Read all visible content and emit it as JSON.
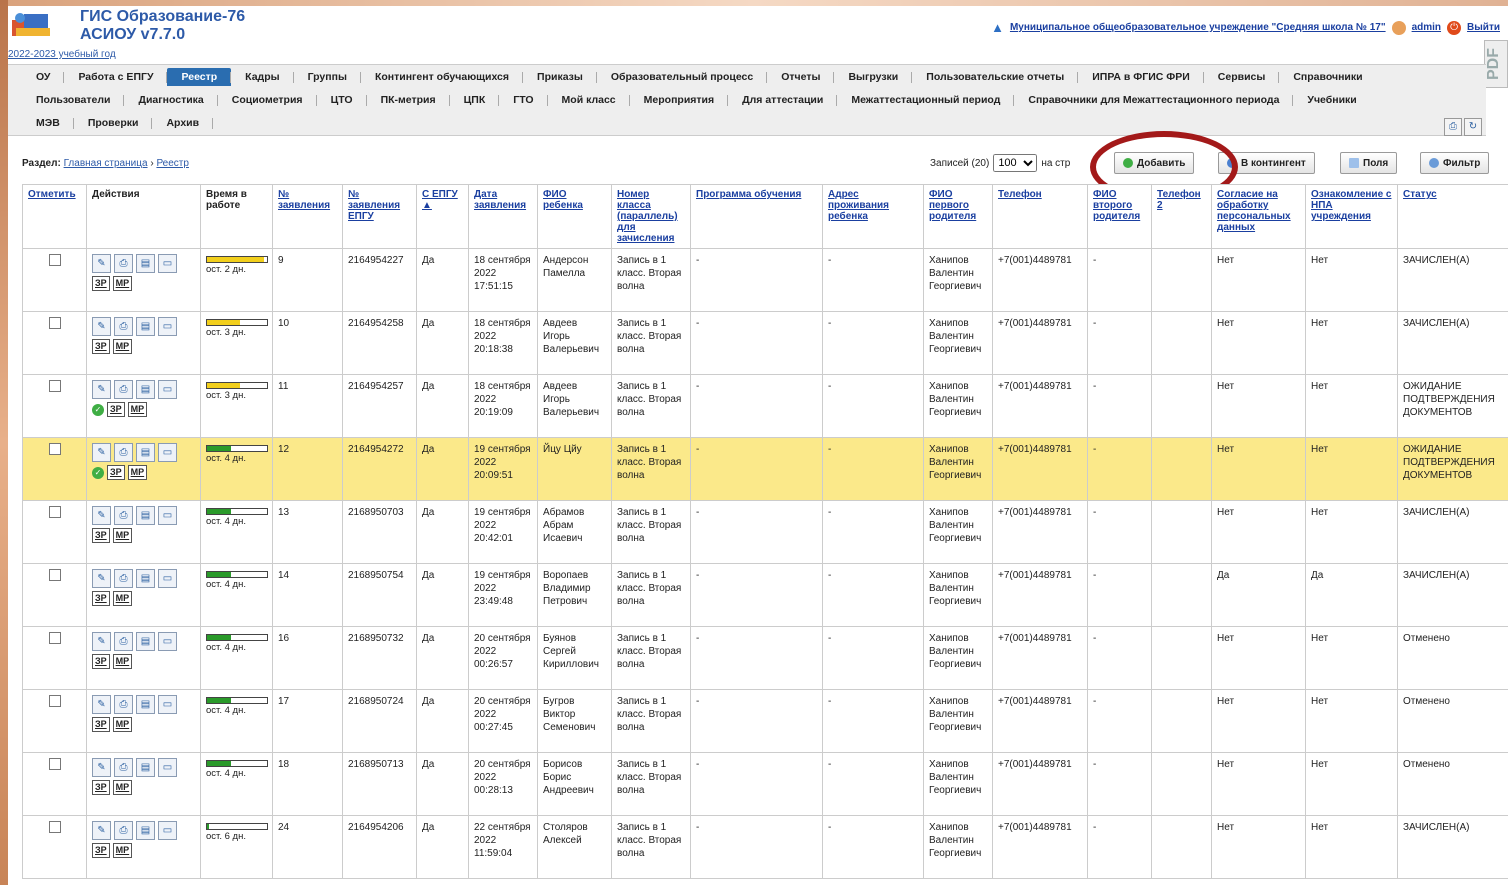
{
  "header": {
    "title_line1": "ГИС Образование-76",
    "title_line2": "АСИОУ v7.7.0",
    "year_link": "2022-2023 учебный год",
    "org_link": "Муниципальное общеобразовательное учреждение \"Средняя школа № 17\"",
    "user": "admin",
    "exit": "Выйти",
    "pdf_badge": "PDF"
  },
  "menu": {
    "row1": [
      "ОУ",
      "Работа с ЕПГУ",
      "Реестр",
      "Кадры",
      "Группы",
      "Контингент обучающихся",
      "Приказы",
      "Образовательный процесс",
      "Отчеты",
      "Выгрузки",
      "Пользовательские отчеты",
      "ИПРА в ФГИС ФРИ",
      "Сервисы",
      "Справочники"
    ],
    "row2": [
      "Пользователи",
      "Диагностика",
      "Социометрия",
      "ЦТО",
      "ПК-метрия",
      "ЦПК",
      "ГТО",
      "Мой класс",
      "Мероприятия",
      "Для аттестации",
      "Межаттестационный период",
      "Справочники для Межаттестационного периода",
      "Учебники"
    ],
    "row3": [
      "МЭВ",
      "Проверки",
      "Архив"
    ],
    "active": "Реестр"
  },
  "toolbar": {
    "section_label": "Раздел:",
    "crumb_home": "Главная страница",
    "crumb_sep": "›",
    "crumb_current": "Реестр",
    "records_label": "Записей (20)",
    "per_page": "100",
    "per_page_suffix": "на стр",
    "add": "Добавить",
    "to_contingent": "В контингент",
    "fields": "Поля",
    "filter": "Фильтр"
  },
  "table": {
    "headers": [
      "Отметить",
      "Действия",
      "Время в работе",
      "№ заявления",
      "№ заявления ЕПГУ",
      "С ЕПГУ ▲",
      "Дата заявления",
      "ФИО ребенка",
      "Номер класса (параллель) для зачисления",
      "Программа обучения",
      "Адрес проживания ребенка",
      "ФИО первого родителя",
      "Телефон",
      "ФИО второго родителя",
      "Телефон 2",
      "Согласие на обработку персональных данных",
      "Ознакомление с НПА учреждения",
      "Статус"
    ],
    "tag_er": "ЗР",
    "tag_mr": "МР",
    "rows": [
      {
        "days": "ост. 2 дн.",
        "fill": 0.95,
        "color": "#f2cf1c",
        "num": "9",
        "epgu": "2164954227",
        "from_epgu": "Да",
        "date": "18 сентября 2022 17:51:15",
        "fio": "Андерсон Памелла",
        "class": "Запись в 1 класс. Вторая волна",
        "prog": "-",
        "addr": "-",
        "parent": "Ханипов Валентин Георгиевич",
        "phone": "+7(001)4489781",
        "parent2": "-",
        "phone2": "",
        "consent": "Нет",
        "npa": "Нет",
        "status": "ЗАЧИСЛЕН(А)",
        "ok": false,
        "hl": false
      },
      {
        "days": "ост. 3 дн.",
        "fill": 0.55,
        "color": "#f2cf1c",
        "num": "10",
        "epgu": "2164954258",
        "from_epgu": "Да",
        "date": "18 сентября 2022 20:18:38",
        "fio": "Авдеев Игорь Валерьевич",
        "class": "Запись в 1 класс. Вторая волна",
        "prog": "-",
        "addr": "-",
        "parent": "Ханипов Валентин Георгиевич",
        "phone": "+7(001)4489781",
        "parent2": "-",
        "phone2": "",
        "consent": "Нет",
        "npa": "Нет",
        "status": "ЗАЧИСЛЕН(А)",
        "ok": false,
        "hl": false
      },
      {
        "days": "ост. 3 дн.",
        "fill": 0.55,
        "color": "#f2cf1c",
        "num": "11",
        "epgu": "2164954257",
        "from_epgu": "Да",
        "date": "18 сентября 2022 20:19:09",
        "fio": "Авдеев Игорь Валерьевич",
        "class": "Запись в 1 класс. Вторая волна",
        "prog": "-",
        "addr": "-",
        "parent": "Ханипов Валентин Георгиевич",
        "phone": "+7(001)4489781",
        "parent2": "-",
        "phone2": "",
        "consent": "Нет",
        "npa": "Нет",
        "status": "ОЖИДАНИЕ ПОДТВЕРЖДЕНИЯ ДОКУМЕНТОВ",
        "ok": true,
        "hl": false
      },
      {
        "days": "ост. 4 дн.",
        "fill": 0.4,
        "color": "#2a9a2a",
        "num": "12",
        "epgu": "2164954272",
        "from_epgu": "Да",
        "date": "19 сентября 2022 20:09:51",
        "fio": "Йцу Цйу",
        "class": "Запись в 1 класс. Вторая волна",
        "prog": "-",
        "addr": "-",
        "parent": "Ханипов Валентин Георгиевич",
        "phone": "+7(001)4489781",
        "parent2": "-",
        "phone2": "",
        "consent": "Нет",
        "npa": "Нет",
        "status": "ОЖИДАНИЕ ПОДТВЕРЖДЕНИЯ ДОКУМЕНТОВ",
        "ok": true,
        "hl": true
      },
      {
        "days": "ост. 4 дн.",
        "fill": 0.4,
        "color": "#2a9a2a",
        "num": "13",
        "epgu": "2168950703",
        "from_epgu": "Да",
        "date": "19 сентября 2022 20:42:01",
        "fio": "Абрамов Абрам Исаевич",
        "class": "Запись в 1 класс. Вторая волна",
        "prog": "-",
        "addr": "-",
        "parent": "Ханипов Валентин Георгиевич",
        "phone": "+7(001)4489781",
        "parent2": "-",
        "phone2": "",
        "consent": "Нет",
        "npa": "Нет",
        "status": "ЗАЧИСЛЕН(А)",
        "ok": false,
        "hl": false
      },
      {
        "days": "ост. 4 дн.",
        "fill": 0.4,
        "color": "#2a9a2a",
        "num": "14",
        "epgu": "2168950754",
        "from_epgu": "Да",
        "date": "19 сентября 2022 23:49:48",
        "fio": "Воропаев Владимир Петрович",
        "class": "Запись в 1 класс. Вторая волна",
        "prog": "-",
        "addr": "-",
        "parent": "Ханипов Валентин Георгиевич",
        "phone": "+7(001)4489781",
        "parent2": "-",
        "phone2": "",
        "consent": "Да",
        "npa": "Да",
        "status": "ЗАЧИСЛЕН(А)",
        "ok": false,
        "hl": false
      },
      {
        "days": "ост. 4 дн.",
        "fill": 0.4,
        "color": "#2a9a2a",
        "num": "16",
        "epgu": "2168950732",
        "from_epgu": "Да",
        "date": "20 сентября 2022 00:26:57",
        "fio": "Буянов Сергей Кириллович",
        "class": "Запись в 1 класс. Вторая волна",
        "prog": "-",
        "addr": "-",
        "parent": "Ханипов Валентин Георгиевич",
        "phone": "+7(001)4489781",
        "parent2": "-",
        "phone2": "",
        "consent": "Нет",
        "npa": "Нет",
        "status": "Отменено",
        "ok": false,
        "hl": false
      },
      {
        "days": "ост. 4 дн.",
        "fill": 0.4,
        "color": "#2a9a2a",
        "num": "17",
        "epgu": "2168950724",
        "from_epgu": "Да",
        "date": "20 сентября 2022 00:27:45",
        "fio": "Бугров Виктор Семенович",
        "class": "Запись в 1 класс. Вторая волна",
        "prog": "-",
        "addr": "-",
        "parent": "Ханипов Валентин Георгиевич",
        "phone": "+7(001)4489781",
        "parent2": "-",
        "phone2": "",
        "consent": "Нет",
        "npa": "Нет",
        "status": "Отменено",
        "ok": false,
        "hl": false
      },
      {
        "days": "ост. 4 дн.",
        "fill": 0.4,
        "color": "#2a9a2a",
        "num": "18",
        "epgu": "2168950713",
        "from_epgu": "Да",
        "date": "20 сентября 2022 00:28:13",
        "fio": "Борисов Борис Андреевич",
        "class": "Запись в 1 класс. Вторая волна",
        "prog": "-",
        "addr": "-",
        "parent": "Ханипов Валентин Георгиевич",
        "phone": "+7(001)4489781",
        "parent2": "-",
        "phone2": "",
        "consent": "Нет",
        "npa": "Нет",
        "status": "Отменено",
        "ok": false,
        "hl": false
      },
      {
        "days": "ост. 6 дн.",
        "fill": 0.03,
        "color": "#2a9a2a",
        "num": "24",
        "epgu": "2164954206",
        "from_epgu": "Да",
        "date": "22 сентября 2022 11:59:04",
        "fio": "Столяров Алексей",
        "class": "Запись в 1 класс. Вторая волна",
        "prog": "-",
        "addr": "-",
        "parent": "Ханипов Валентин Георгиевич",
        "phone": "+7(001)4489781",
        "parent2": "-",
        "phone2": "",
        "consent": "Нет",
        "npa": "Нет",
        "status": "ЗАЧИСЛЕН(А)",
        "ok": false,
        "hl": false
      }
    ]
  }
}
